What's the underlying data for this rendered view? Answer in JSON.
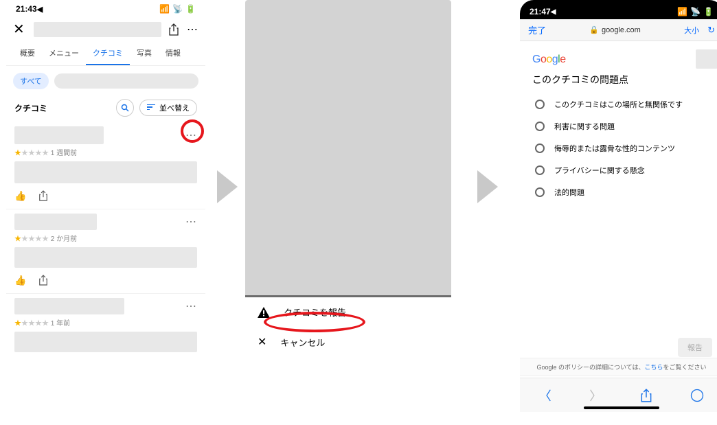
{
  "screen1": {
    "time": "21:43",
    "tabs": [
      "概要",
      "メニュー",
      "クチコミ",
      "写真",
      "情報"
    ],
    "active_tab": 2,
    "chip_all": "すべて",
    "section": "クチコミ",
    "sort_label": "並べ替え",
    "reviews": [
      {
        "stars": 1,
        "age": "1 週間前"
      },
      {
        "stars": 1,
        "age": "2 か月前"
      },
      {
        "stars": 1,
        "age": "1 年前"
      }
    ]
  },
  "screen2": {
    "report": "クチコミを報告",
    "cancel": "キャンセル"
  },
  "screen3": {
    "time": "21:47",
    "done": "完了",
    "host": "google.com",
    "textsize": "大小",
    "title": "このクチコミの問題点",
    "options": [
      "このクチコミはこの場所と無関係です",
      "利害に関する問題",
      "侮辱的または露骨な性的コンテンツ",
      "プライバシーに関する懸念",
      "法的問題"
    ],
    "report_btn": "報告",
    "policy_pre": "Google のポリシーの詳細については、",
    "policy_link": "こちら",
    "policy_post": "をご覧ください"
  }
}
